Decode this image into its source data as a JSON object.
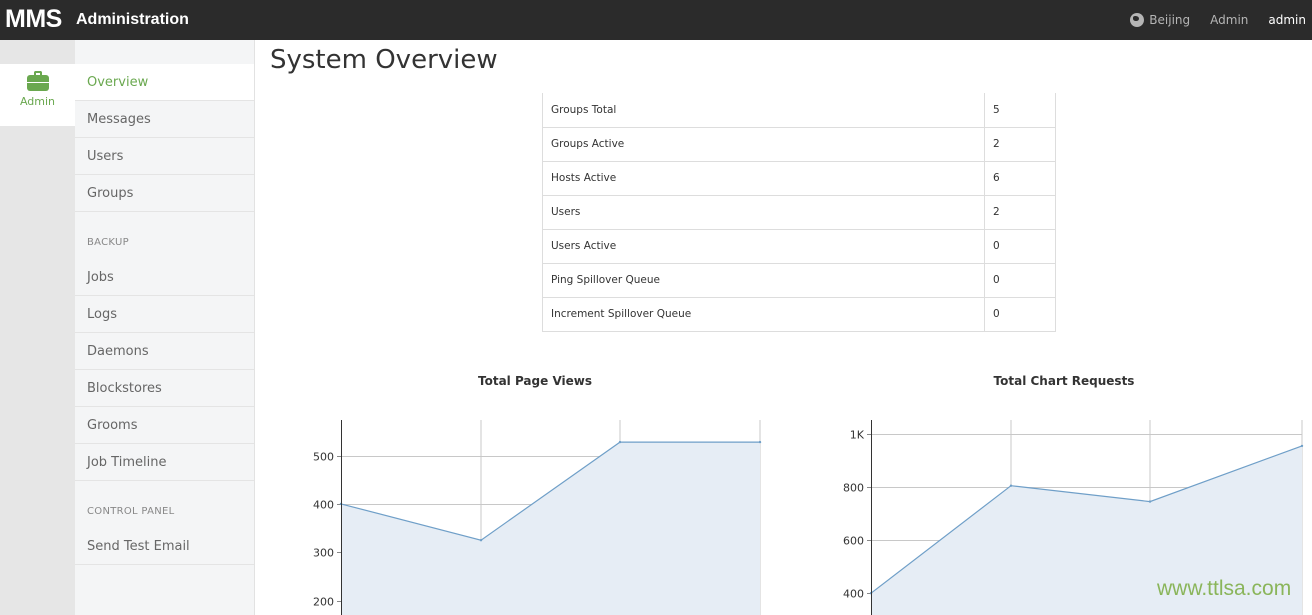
{
  "app": {
    "brand": "MMS",
    "section": "Administration"
  },
  "topnav": {
    "location": "Beijing",
    "admin_link": "Admin",
    "user": "admin",
    "location_icon": "globe-icon"
  },
  "rail": {
    "label": "Admin",
    "icon": "briefcase-icon"
  },
  "sidebar": {
    "items": [
      "Overview",
      "Messages",
      "Users",
      "Groups"
    ],
    "backup_header": "BACKUP",
    "backup_items": [
      "Jobs",
      "Logs",
      "Daemons",
      "Blockstores",
      "Grooms",
      "Job Timeline"
    ],
    "control_header": "CONTROL PANEL",
    "control_items": [
      "Send Test Email"
    ]
  },
  "page": {
    "title": "System Overview"
  },
  "stats": [
    {
      "label": "Groups Total",
      "value": "5"
    },
    {
      "label": "Groups Active",
      "value": "2"
    },
    {
      "label": "Hosts Active",
      "value": "6"
    },
    {
      "label": "Users",
      "value": "2"
    },
    {
      "label": "Users Active",
      "value": "0"
    },
    {
      "label": "Ping Spillover Queue",
      "value": "0"
    },
    {
      "label": "Increment Spillover Queue",
      "value": "0"
    }
  ],
  "chart_data": [
    {
      "type": "area",
      "title": "Total Page Views",
      "x": [
        0,
        1,
        2,
        3
      ],
      "values": [
        400,
        325,
        528,
        528
      ],
      "ytick_labels": [
        "500",
        "400",
        "300",
        "200"
      ],
      "ytick_values": [
        500,
        400,
        300,
        200
      ],
      "ylim": [
        170,
        578
      ],
      "grid": true,
      "line_color": "#6f9fc8",
      "fill_color": "#e6edf5"
    },
    {
      "type": "area",
      "title": "Total Chart Requests",
      "x": [
        0,
        1,
        2,
        3
      ],
      "values": [
        400,
        805,
        745,
        955
      ],
      "ytick_labels": [
        "1K",
        "800",
        "600",
        "400"
      ],
      "ytick_values": [
        1000,
        800,
        600,
        400
      ],
      "ylim": [
        318,
        1060
      ],
      "grid": true,
      "line_color": "#6f9fc8",
      "fill_color": "#e6edf5"
    }
  ],
  "watermark": "www.ttlsa.com"
}
